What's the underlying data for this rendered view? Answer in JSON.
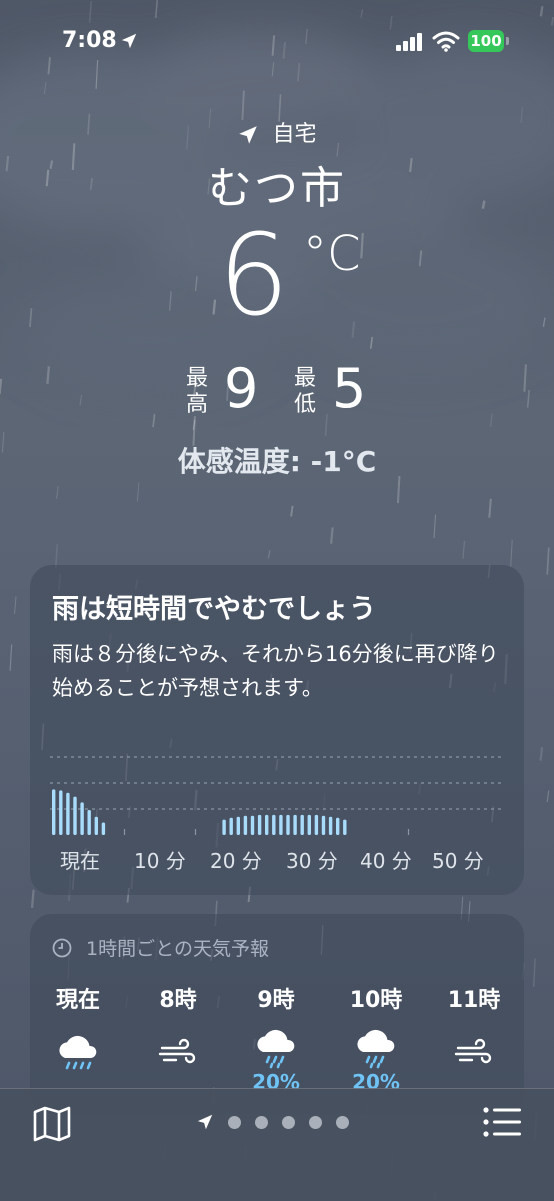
{
  "status_bar": {
    "time": "7:08",
    "battery": "100"
  },
  "location": {
    "home_label": "自宅",
    "city": "むつ市"
  },
  "current": {
    "temperature": "6",
    "unit": "°C",
    "high_label": "最高",
    "high": "9",
    "low_label": "最低",
    "low": "5",
    "feels_like": "体感温度: -1°C"
  },
  "precip_card": {
    "title": "雨は短時間でやむでしょう",
    "body": "雨は８分後にやみ、それから16分後に再び降り始めることが予想されます。",
    "ticks": [
      "現在",
      "10 分",
      "20 分",
      "30 分",
      "40 分",
      "50 分"
    ],
    "minute_intensity": [
      0.95,
      0.93,
      0.88,
      0.8,
      0.68,
      0.52,
      0.38,
      0.26,
      0,
      0,
      0,
      0,
      0,
      0,
      0,
      0,
      0,
      0,
      0,
      0,
      0,
      0,
      0,
      0,
      0.32,
      0.36,
      0.38,
      0.4,
      0.4,
      0.42,
      0.42,
      0.42,
      0.42,
      0.42,
      0.42,
      0.42,
      0.42,
      0.42,
      0.4,
      0.38,
      0.36,
      0.32,
      0,
      0,
      0,
      0,
      0,
      0,
      0,
      0,
      0,
      0,
      0,
      0,
      0,
      0,
      0,
      0,
      0,
      0
    ]
  },
  "hourly_card": {
    "header": "1時間ごとの天気予報",
    "hours": [
      {
        "label": "現在",
        "icon": "cloud-rain-icon",
        "precip": ""
      },
      {
        "label": "8時",
        "icon": "wind-icon",
        "precip": ""
      },
      {
        "label": "9時",
        "icon": "cloud-rain-icon",
        "precip": "20%"
      },
      {
        "label": "10時",
        "icon": "cloud-rain-icon",
        "precip": "20%"
      },
      {
        "label": "11時",
        "icon": "wind-icon",
        "precip": ""
      }
    ]
  },
  "tab_bar": {
    "page_count": 5,
    "active_page": "location"
  },
  "colors": {
    "accent_rain": "#6fc3f5",
    "battery": "#35c759"
  }
}
